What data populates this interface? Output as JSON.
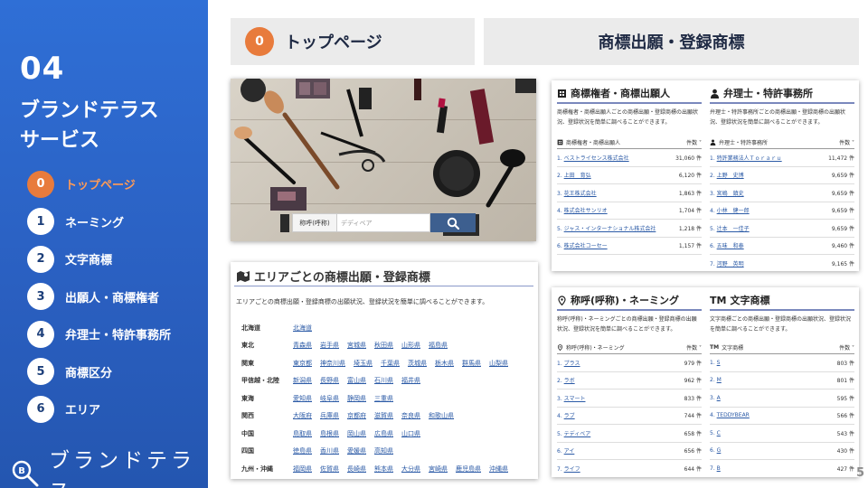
{
  "sidebar": {
    "section_number": "04",
    "section_title": "ブランドテラス\nサービス",
    "nav": [
      {
        "num": "0",
        "label": "トップページ",
        "active": true
      },
      {
        "num": "1",
        "label": "ネーミング"
      },
      {
        "num": "2",
        "label": "文字商標"
      },
      {
        "num": "3",
        "label": "出願人・商標権者"
      },
      {
        "num": "4",
        "label": "弁理士・特許事務所"
      },
      {
        "num": "5",
        "label": "商標区分"
      },
      {
        "num": "6",
        "label": "エリア"
      }
    ],
    "logo_text": "ブランドテラス"
  },
  "header": {
    "left_badge": "0",
    "left_title": "トップページ",
    "right_title": "商標出願・登録商標"
  },
  "hero": {
    "search_label": "称呼(呼称)",
    "search_placeholder": "デディベア"
  },
  "area": {
    "title": "エリアごとの商標出願・登録商標",
    "desc": "エリアごとの商標出願・登録商標の出願状況、登録状況を簡単に調べることができます。",
    "rows": [
      {
        "region": "北海道",
        "prefs": [
          "北海道"
        ]
      },
      {
        "region": "東北",
        "prefs": [
          "青森県",
          "岩手県",
          "宮城県",
          "秋田県",
          "山形県",
          "福島県"
        ]
      },
      {
        "region": "関東",
        "prefs": [
          "東京都",
          "神奈川県",
          "埼玉県",
          "千葉県",
          "茨城県",
          "栃木県",
          "群馬県",
          "山梨県"
        ]
      },
      {
        "region": "甲信越・北陸",
        "prefs": [
          "新潟県",
          "長野県",
          "富山県",
          "石川県",
          "福井県"
        ]
      },
      {
        "region": "東海",
        "prefs": [
          "愛知県",
          "岐阜県",
          "静岡県",
          "三重県"
        ]
      },
      {
        "region": "関西",
        "prefs": [
          "大阪府",
          "兵庫県",
          "京都府",
          "滋賀県",
          "奈良県",
          "和歌山県"
        ]
      },
      {
        "region": "中国",
        "prefs": [
          "鳥取県",
          "島根県",
          "岡山県",
          "広島県",
          "山口県"
        ]
      },
      {
        "region": "四国",
        "prefs": [
          "徳島県",
          "香川県",
          "愛媛県",
          "高知県"
        ]
      },
      {
        "region": "九州・沖縄",
        "prefs": [
          "福岡県",
          "佐賀県",
          "長崎県",
          "熊本県",
          "大分県",
          "宮崎県",
          "鹿児島県",
          "沖縄県"
        ]
      }
    ]
  },
  "owners": {
    "title": "商標権者・商標出願人",
    "desc": "商標権者・商標出願人ごとの商標出願・登録商標の出願状況、登録状況を簡単に調べることができます。",
    "col_name": "商標権者・商標出願人",
    "col_count": "件数",
    "rows": [
      {
        "rank": "1.",
        "name": "ベストライセンス株式会社",
        "count": "31,060",
        "unit": "件"
      },
      {
        "rank": "2.",
        "name": "上田　育弘",
        "count": "6,120",
        "unit": "件"
      },
      {
        "rank": "3.",
        "name": "花王株式会社",
        "count": "1,863",
        "unit": "件"
      },
      {
        "rank": "4.",
        "name": "株式会社サンリオ",
        "count": "1,704",
        "unit": "件"
      },
      {
        "rank": "5.",
        "name": "ジャス・インターナショナル株式会社",
        "count": "1,218",
        "unit": "件"
      },
      {
        "rank": "6.",
        "name": "株式会社コーセー",
        "count": "1,157",
        "unit": "件"
      }
    ]
  },
  "attorneys": {
    "title": "弁理士・特許事務所",
    "desc": "弁理士・特許事務所ごとの商標出願・登録商標の出願状況、登録状況を簡単に調べることができます。",
    "col_name": "弁理士・特許事務所",
    "col_count": "件数",
    "rows": [
      {
        "rank": "1.",
        "name": "特許業務法人Ｔｏｒａｒｕ",
        "count": "11,472",
        "unit": "件"
      },
      {
        "rank": "2.",
        "name": "上野　史博",
        "count": "9,659",
        "unit": "件"
      },
      {
        "rank": "3.",
        "name": "宮嶋　鎮史",
        "count": "9,659",
        "unit": "件"
      },
      {
        "rank": "4.",
        "name": "小林　健一郎",
        "count": "9,659",
        "unit": "件"
      },
      {
        "rank": "5.",
        "name": "辻本　一佳子",
        "count": "9,659",
        "unit": "件"
      },
      {
        "rank": "6.",
        "name": "五味　和泰",
        "count": "9,460",
        "unit": "件"
      },
      {
        "rank": "7.",
        "name": "河野　英明",
        "count": "9,165",
        "unit": "件"
      }
    ]
  },
  "naming": {
    "title": "称呼(呼称)・ネーミング",
    "desc": "称呼(呼称)・ネーミングごとの商標出願・登録商標の出願状況、登録状況を簡単に調べることができます。",
    "col_name": "称呼(呼称)・ネーミング",
    "col_count": "件数",
    "rows": [
      {
        "rank": "1.",
        "name": "プラス",
        "count": "979",
        "unit": "件"
      },
      {
        "rank": "2.",
        "name": "ラボ",
        "count": "962",
        "unit": "件"
      },
      {
        "rank": "3.",
        "name": "スマート",
        "count": "833",
        "unit": "件"
      },
      {
        "rank": "4.",
        "name": "ラブ",
        "count": "744",
        "unit": "件"
      },
      {
        "rank": "5.",
        "name": "テディベア",
        "count": "658",
        "unit": "件"
      },
      {
        "rank": "6.",
        "name": "アイ",
        "count": "656",
        "unit": "件"
      },
      {
        "rank": "7.",
        "name": "ライフ",
        "count": "644",
        "unit": "件"
      }
    ]
  },
  "wordmarks": {
    "title": "文字商標",
    "title_prefix": "TM",
    "desc": "文字商標ごとの商標出願・登録商標の出願状況、登録状況を簡単に調べることができます。",
    "col_name": "文字商標",
    "col_count": "件数",
    "rows": [
      {
        "rank": "1.",
        "name": "S",
        "count": "803",
        "unit": "件"
      },
      {
        "rank": "2.",
        "name": "M",
        "count": "801",
        "unit": "件"
      },
      {
        "rank": "3.",
        "name": "A",
        "count": "595",
        "unit": "件"
      },
      {
        "rank": "4.",
        "name": "TEDDYBEAR",
        "count": "566",
        "unit": "件"
      },
      {
        "rank": "5.",
        "name": "C",
        "count": "543",
        "unit": "件"
      },
      {
        "rank": "6.",
        "name": "G",
        "count": "430",
        "unit": "件"
      },
      {
        "rank": "7.",
        "name": "B",
        "count": "427",
        "unit": "件"
      }
    ]
  },
  "page_number": "5"
}
